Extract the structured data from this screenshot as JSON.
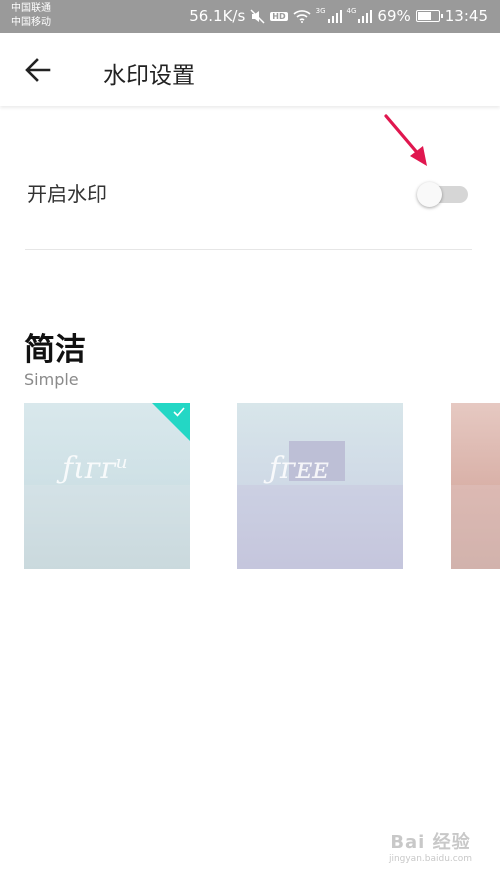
{
  "status_bar": {
    "carrier_1": "中国联通",
    "carrier_2": "中国移动",
    "net_speed": "56.1K/s",
    "hd_label": "HD",
    "sig1_label": "3G",
    "sig2_label": "4G",
    "battery": "69%",
    "battery_level": 0.69,
    "time": "13:45"
  },
  "header": {
    "title": "水印设置"
  },
  "watermark_toggle": {
    "label": "开启水印",
    "enabled": false
  },
  "section": {
    "title": "简洁",
    "subtitle": "Simple"
  },
  "thumbnails": [
    {
      "selected": true
    },
    {
      "selected": false
    },
    {
      "selected": false
    }
  ],
  "footer_watermark": {
    "brand": "Bai 经验",
    "url": "jingyan.baidu.com"
  },
  "colors": {
    "accent": "#23d7c5",
    "arrow": "#e0174f",
    "status_bar": "#9a9a9a"
  },
  "icons": [
    "back-arrow-icon",
    "mute-icon",
    "wifi-icon",
    "signal-icon",
    "battery-icon",
    "check-icon"
  ]
}
